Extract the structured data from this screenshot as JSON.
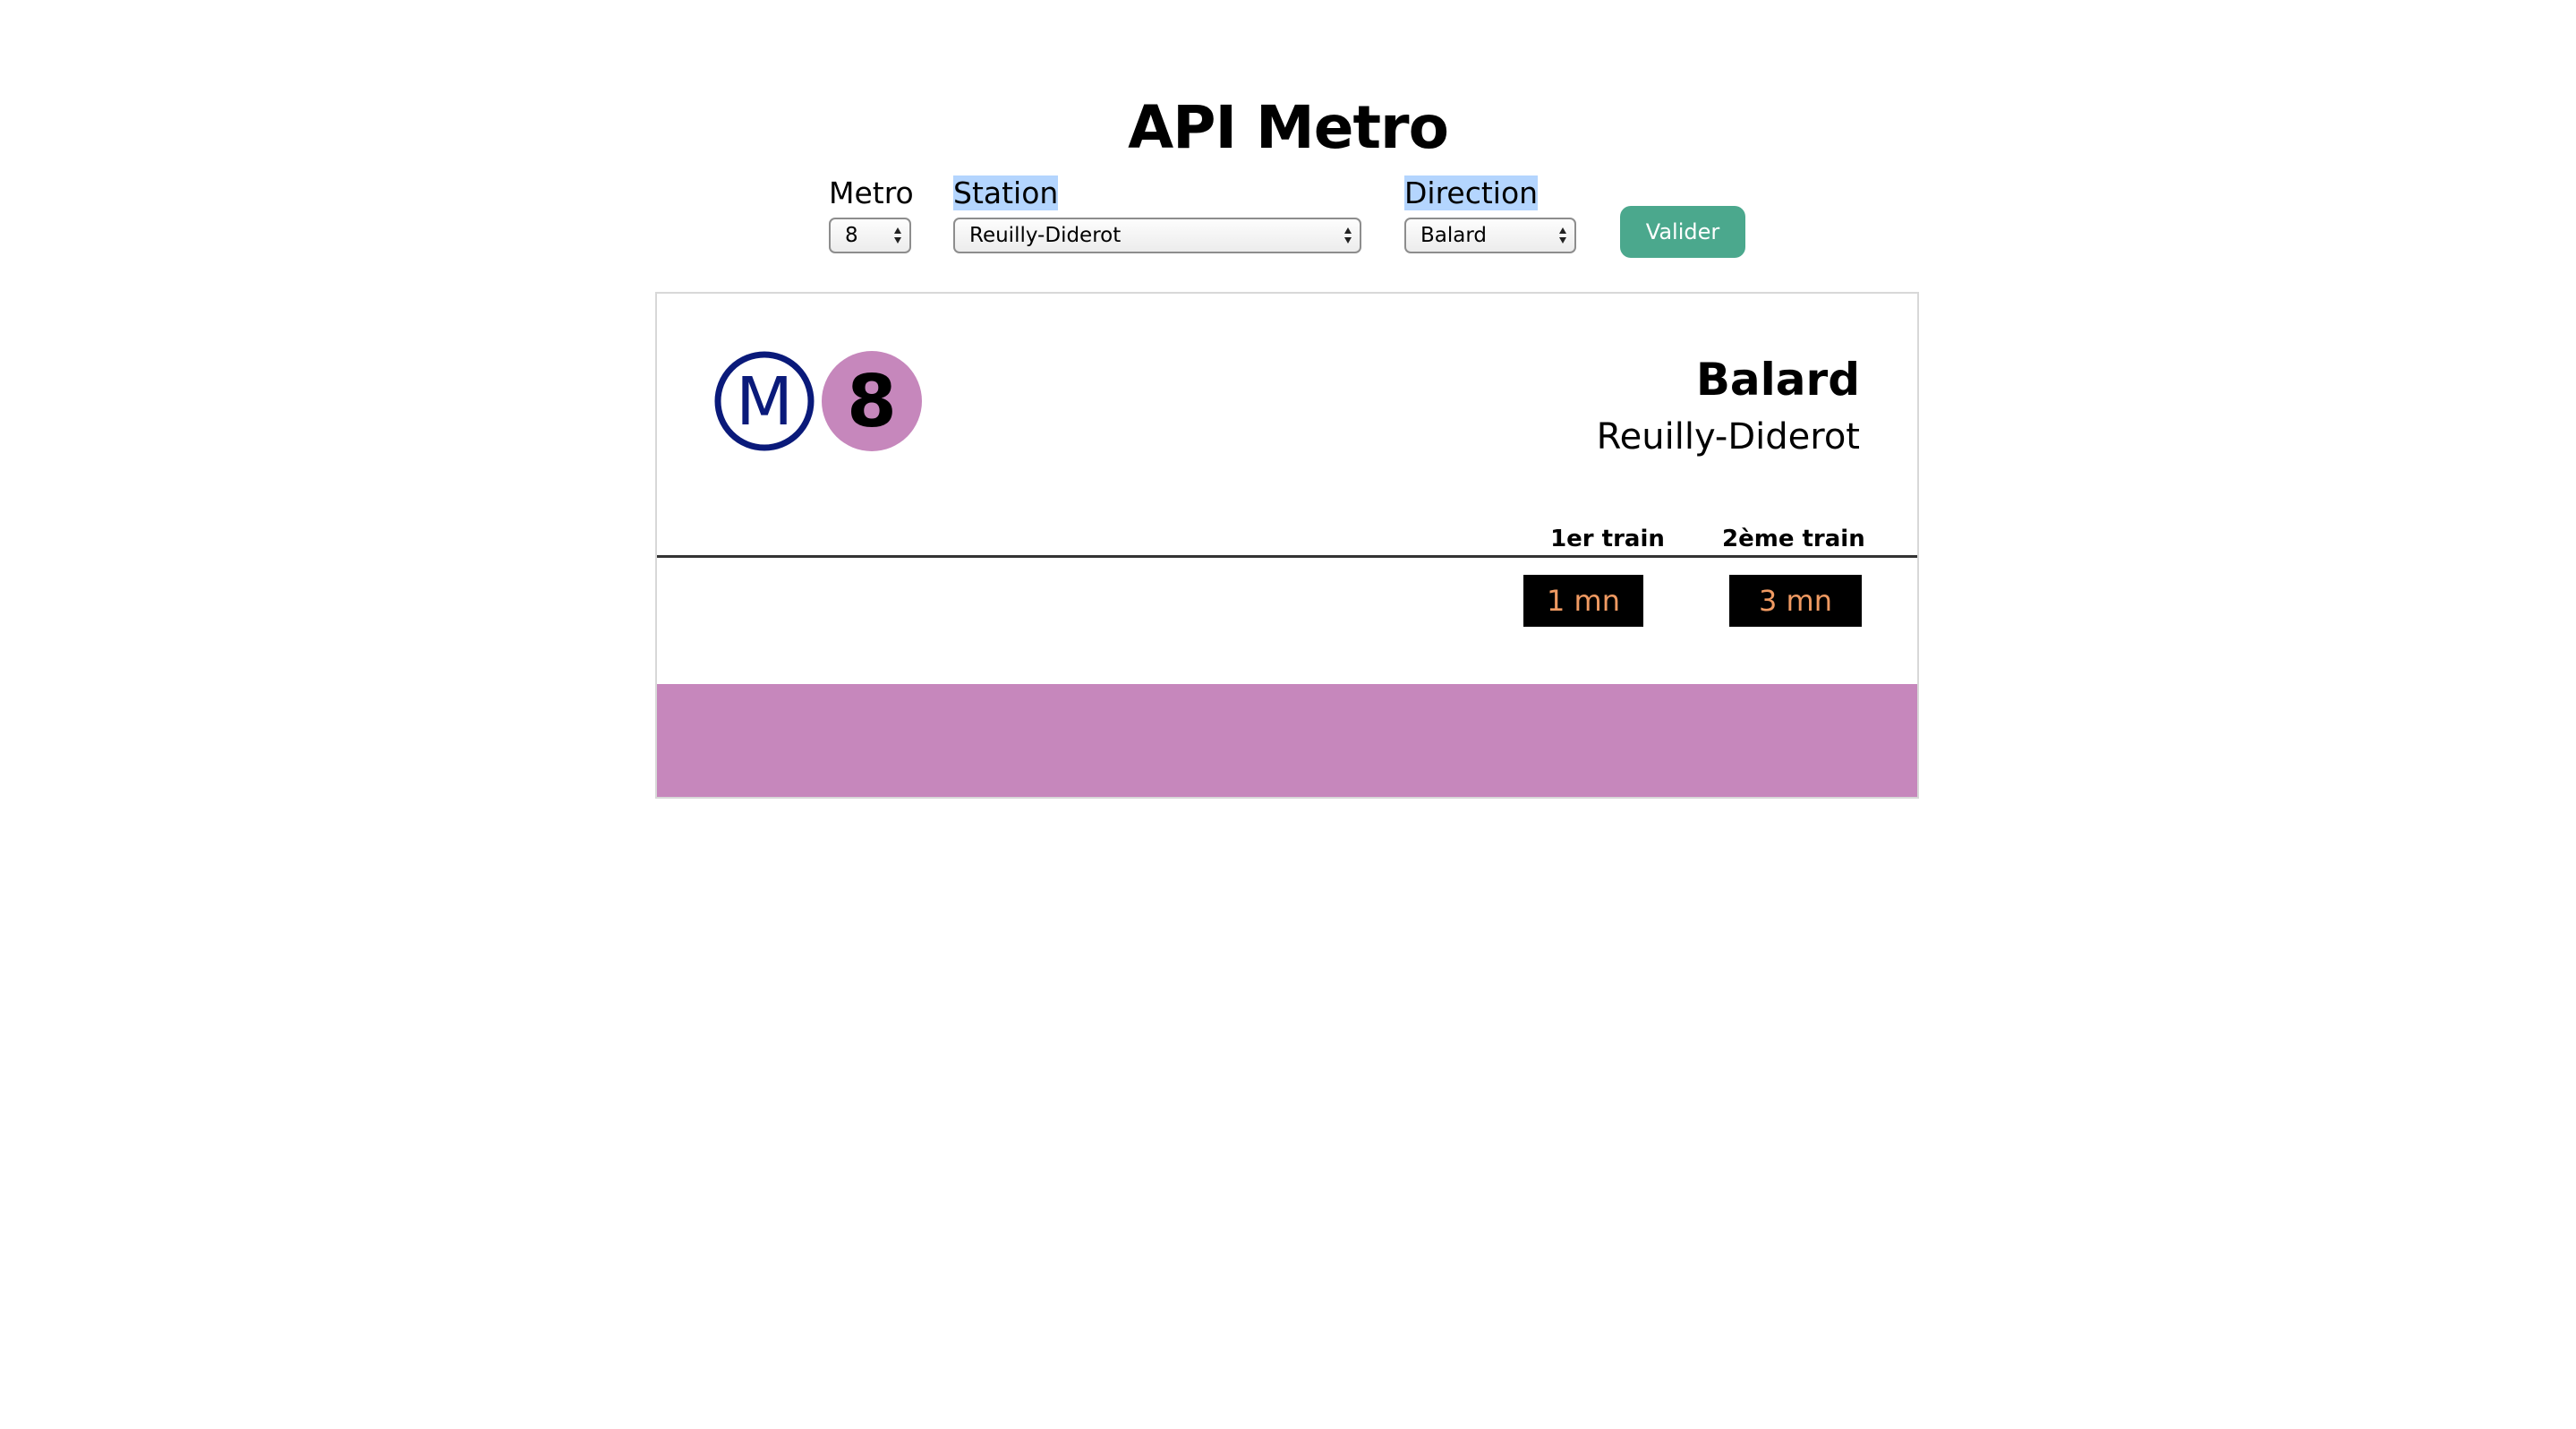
{
  "app": {
    "title": "API Metro"
  },
  "form": {
    "metro_label": "Metro",
    "metro_value": "8",
    "station_label": "Station",
    "station_value": "Reuilly-Diderot",
    "direction_label": "Direction",
    "direction_value": "Balard",
    "submit_label": "Valider"
  },
  "board": {
    "logo_letter": "M",
    "line_number": "8",
    "line_color": "#c687bc",
    "logo_color": "#0a1a7a",
    "direction": "Balard",
    "station": "Reuilly-Diderot",
    "first_train_header": "1er train",
    "second_train_header": "2ème train",
    "first_train_time": "1 mn",
    "second_train_time": "3 mn"
  }
}
